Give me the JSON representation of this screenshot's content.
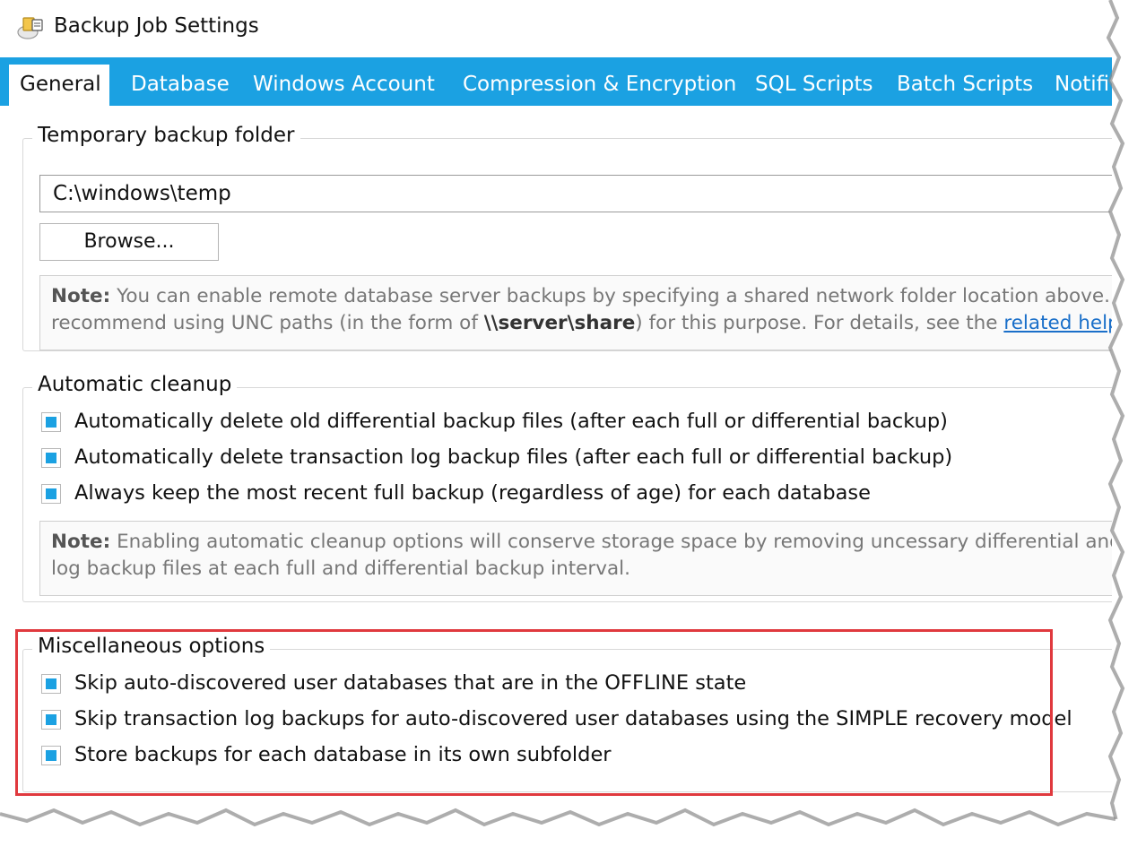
{
  "window": {
    "title": "Backup Job Settings",
    "icon": "backup-job-icon"
  },
  "tabs": [
    {
      "label": "General",
      "active": true
    },
    {
      "label": "Database",
      "active": false
    },
    {
      "label": "Windows Account",
      "active": false
    },
    {
      "label": "Compression & Encryption",
      "active": false
    },
    {
      "label": "SQL Scripts",
      "active": false
    },
    {
      "label": "Batch Scripts",
      "active": false
    },
    {
      "label": "Notifi",
      "active": false
    }
  ],
  "temp_folder": {
    "label": "Temporary backup folder",
    "path_value": "C:\\windows\\temp",
    "browse_label": "Browse...",
    "note_prefix": "Note:",
    "note_line1": " You can enable remote database server backups by specifying a shared network folder location above. W",
    "note_line2_a": "recommend using UNC paths (in the form of ",
    "note_line2_strong": "\\\\server\\share",
    "note_line2_b": ") for this purpose. For details, see the ",
    "note_link": "related help t"
  },
  "cleanup": {
    "label": "Automatic cleanup",
    "options": [
      {
        "label": "Automatically delete old differential backup files (after each full or differential backup)",
        "checked": true
      },
      {
        "label": "Automatically delete transaction log backup files (after each full or differential backup)",
        "checked": true
      },
      {
        "label": "Always keep the most recent full backup (regardless of age) for each database",
        "checked": true
      }
    ],
    "note_prefix": "Note:",
    "note_line1": " Enabling automatic cleanup options will conserve storage space by removing uncessary differential and/o",
    "note_line2": "log backup files at each full and differential backup interval."
  },
  "misc": {
    "label": "Miscellaneous options",
    "options": [
      {
        "label": "Skip auto-discovered user databases that are in the OFFLINE state",
        "checked": true
      },
      {
        "label": "Skip transaction log backups for auto-discovered user databases using the SIMPLE recovery model",
        "checked": true
      },
      {
        "label": "Store backups for each database in its own subfolder",
        "checked": true
      }
    ]
  },
  "colors": {
    "accent": "#1ba1e2",
    "highlight": "#e0393e",
    "link": "#1a6fc9"
  }
}
